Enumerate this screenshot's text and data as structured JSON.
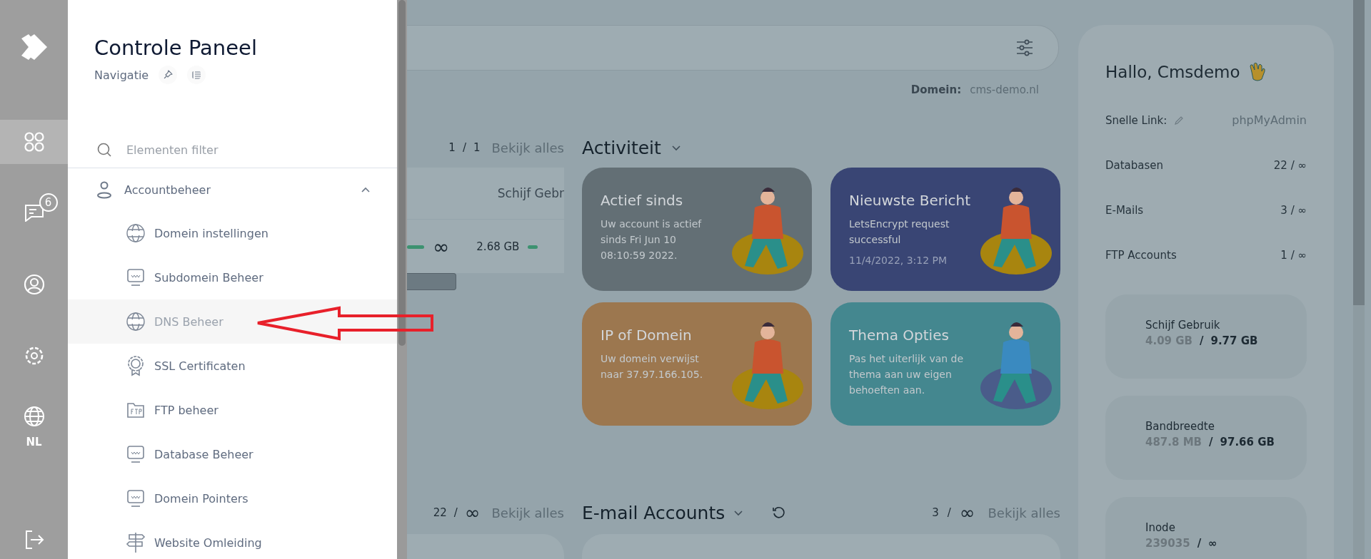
{
  "rail": {
    "items": [
      {
        "kind": "apps",
        "selected": true
      },
      {
        "kind": "chat",
        "selected": false,
        "badge": "6"
      },
      {
        "kind": "user",
        "selected": false
      },
      {
        "kind": "settings",
        "selected": false
      },
      {
        "kind": "globe",
        "selected": false,
        "label": "NL"
      }
    ]
  },
  "nav": {
    "title": "Controle Paneel",
    "subtitle": "Navigatie",
    "filter": {
      "placeholder": "Elementen filter"
    },
    "group": {
      "label": "Accountbeheer",
      "expanded": true,
      "children": [
        {
          "label": "Domein instellingen",
          "kind": "www-globe",
          "selected": false
        },
        {
          "label": "Subdomein Beheer",
          "kind": "www-monitor",
          "selected": false
        },
        {
          "label": "DNS Beheer",
          "kind": "dns",
          "selected": true
        },
        {
          "label": "SSL Certificaten",
          "kind": "ssl",
          "selected": false
        },
        {
          "label": "FTP beheer",
          "kind": "ftp",
          "selected": false
        },
        {
          "label": "Database Beheer",
          "kind": "sql",
          "selected": false
        },
        {
          "label": "Domein Pointers",
          "kind": "www-monitor",
          "selected": false
        },
        {
          "label": "Website Omleiding",
          "kind": "signpost",
          "selected": false
        }
      ]
    }
  },
  "main": {
    "domain": {
      "label": "Domein:",
      "value": "cms-demo.nl"
    },
    "left_counter": {
      "count": "1",
      "sep": "/",
      "total": "1",
      "link": "Bekijk alles"
    },
    "partial_table": {
      "header": "Schijf Gebr",
      "cells": [
        "∞",
        "2.68 GB"
      ]
    },
    "activity": {
      "title": "Activiteit",
      "cards": [
        {
          "title": "Actief sinds",
          "text": "Uw account is actief sinds Fri Jun 10 08:10:59 2022.",
          "color": "#636f75"
        },
        {
          "title": "Nieuwste Bericht",
          "text": "LetsEncrypt request successful",
          "date": "11/4/2022, 3:12 PM",
          "color": "#394574"
        },
        {
          "title": "IP of Domein",
          "text": "Uw domein verwijst naar 37.97.166.105.",
          "color": "#9c774f"
        },
        {
          "title": "Thema Opties",
          "text": "Pas het uiterlijk van de thema aan uw eigen behoeften aan.",
          "color": "#44878f"
        }
      ]
    },
    "db_counter": {
      "count": "22",
      "sep": "/",
      "total": "∞",
      "link": "Bekijk alles"
    },
    "email": {
      "title": "E-mail Accounts",
      "count": "3",
      "sep": "/",
      "total": "∞",
      "link": "Bekijk alles"
    }
  },
  "profile": {
    "greeting": "Hallo, Cmsdemo",
    "quick_link": {
      "label": "Snelle Link:",
      "value": "phpMyAdmin"
    },
    "stats": [
      {
        "label": "Databasen",
        "value": "22 / ∞"
      },
      {
        "label": "E-Mails",
        "value": "3 / ∞"
      },
      {
        "label": "FTP Accounts",
        "value": "1 / ∞"
      }
    ],
    "usage": [
      {
        "label": "Schijf Gebruik",
        "used": "4.09 GB",
        "sep": "/",
        "total": "9.77 GB"
      },
      {
        "label": "Bandbreedte",
        "used": "487.8 MB",
        "sep": "/",
        "total": "97.66 GB"
      },
      {
        "label": "Inode",
        "used": "239035",
        "sep": "/",
        "total": "∞"
      }
    ]
  }
}
